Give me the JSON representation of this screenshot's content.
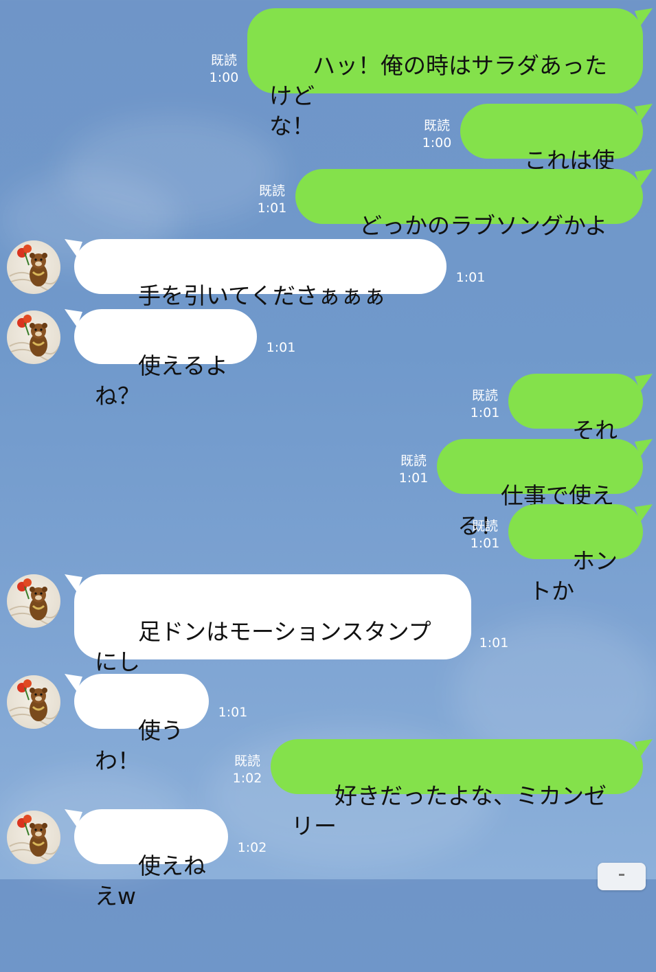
{
  "messages": [
    {
      "side": "out",
      "text": "ハッ！俺の時はサラダあったけど\nな！",
      "read": "既読",
      "time": "1:00"
    },
    {
      "side": "out",
      "text": "これは使えん",
      "read": "既読",
      "time": "1:00"
    },
    {
      "side": "out",
      "text": "どっかのラブソングかよっ！",
      "read": "既読",
      "time": "1:01"
    },
    {
      "side": "in",
      "text": "手を引いてくださぁぁぁい！！",
      "time": "1:01"
    },
    {
      "side": "in",
      "text": "使えるよね？",
      "time": "1:01"
    },
    {
      "side": "out",
      "text": "それな！",
      "read": "既読",
      "time": "1:01"
    },
    {
      "side": "out",
      "text": "仕事で使える！",
      "read": "既読",
      "time": "1:01"
    },
    {
      "side": "out",
      "text": "ホントか",
      "read": "既読",
      "time": "1:01"
    },
    {
      "side": "in",
      "text": "足ドンはモーションスタンプにし\nろ",
      "time": "1:01"
    },
    {
      "side": "in",
      "text": "使うわ！",
      "time": "1:01"
    },
    {
      "side": "out",
      "text": "好きだったよな、ミカンゼリー",
      "read": "既読",
      "time": "1:02"
    },
    {
      "side": "in",
      "text": "使えねえw",
      "time": "1:02"
    }
  ],
  "colors": {
    "outgoing_bubble": "#84e14b",
    "incoming_bubble": "#ffffff",
    "background": "#7099cb"
  },
  "icons": {
    "avatar": "bear-mascot-avatar-icon",
    "scroll_button": "scroll-down-icon"
  }
}
